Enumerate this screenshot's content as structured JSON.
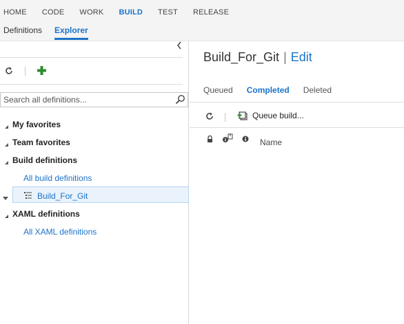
{
  "topnav": {
    "hubs": [
      {
        "label": "HOME"
      },
      {
        "label": "CODE"
      },
      {
        "label": "WORK"
      },
      {
        "label": "BUILD",
        "active": true
      },
      {
        "label": "TEST"
      },
      {
        "label": "RELEASE"
      }
    ],
    "subtabs": [
      {
        "label": "Definitions"
      },
      {
        "label": "Explorer",
        "active": true
      }
    ]
  },
  "left": {
    "search_placeholder": "Search all definitions...",
    "tree": {
      "my_favorites": "My favorites",
      "team_favorites": "Team favorites",
      "build_definitions": "Build definitions",
      "all_build_definitions": "All build definitions",
      "build_for_git": "Build_For_Git",
      "xaml_definitions": "XAML definitions",
      "all_xaml_definitions": "All XAML definitions"
    }
  },
  "right": {
    "title": "Build_For_Git",
    "separator": "|",
    "edit": "Edit",
    "tabs": [
      {
        "label": "Queued"
      },
      {
        "label": "Completed",
        "active": true
      },
      {
        "label": "Deleted"
      }
    ],
    "queue_build": "Queue build...",
    "column_name": "Name"
  },
  "colors": {
    "accent": "#1a73c8",
    "add_green": "#2e8b2e",
    "selected_bg": "#eaf3fb"
  },
  "icons": [
    "refresh-icon",
    "add-icon",
    "search-icon",
    "collapse-chevron-icon",
    "tree-expand-icon",
    "definition-icon",
    "queue-build-icon",
    "lock-icon",
    "build-reason-icon",
    "info-icon"
  ]
}
